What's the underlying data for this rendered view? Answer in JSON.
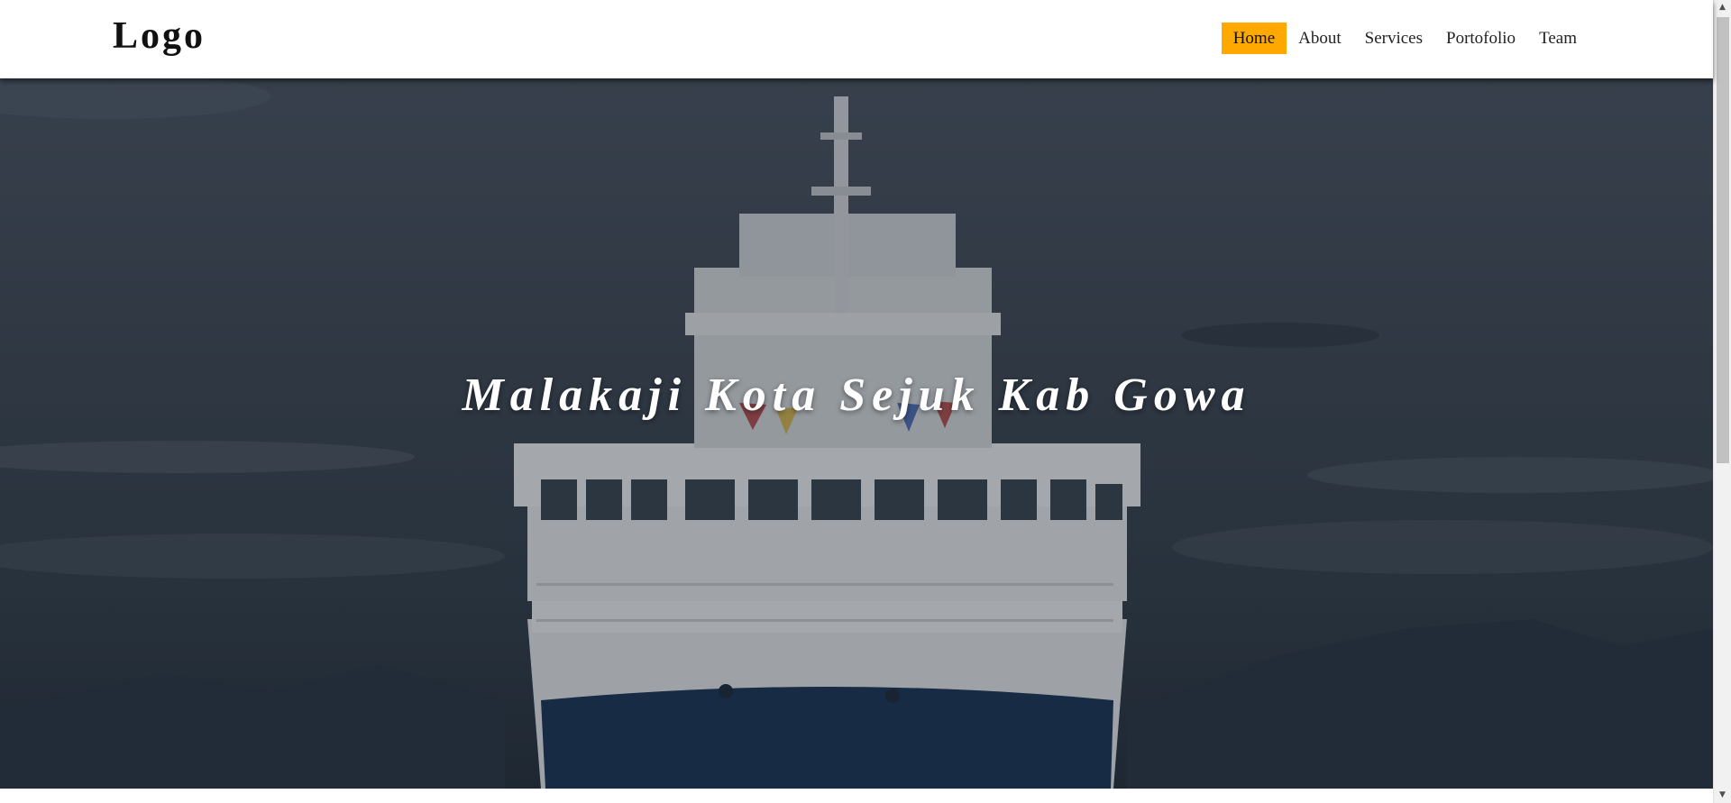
{
  "header": {
    "logo": "Logo",
    "nav": [
      {
        "label": "Home",
        "active": true
      },
      {
        "label": "About",
        "active": false
      },
      {
        "label": "Services",
        "active": false
      },
      {
        "label": "Portofolio",
        "active": false
      },
      {
        "label": "Team",
        "active": false
      }
    ]
  },
  "hero": {
    "title": "Malakaji Kota Sejuk Kab Gowa",
    "background_image": "ship-at-sea"
  },
  "colors": {
    "accent": "#ffa800",
    "header_bg": "#ffffff",
    "hero_text": "#ffffff"
  },
  "icons": {
    "scroll_up": "scroll-up-arrow-icon",
    "scroll_down": "scroll-down-arrow-icon"
  }
}
